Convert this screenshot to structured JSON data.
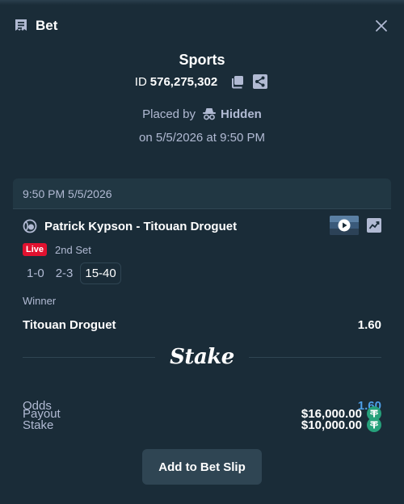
{
  "header": {
    "title": "Bet"
  },
  "bet": {
    "category": "Sports",
    "id_prefix": "ID",
    "id": "576,275,302",
    "placed_by_label": "Placed by",
    "placed_by_user": "Hidden",
    "placed_on": "on 5/5/2026 at 9:50 PM"
  },
  "card": {
    "time": "9:50 PM 5/5/2026",
    "event": "Patrick Kypson - Titouan Droguet",
    "live_badge": "Live",
    "period": "2nd Set",
    "scores": [
      "1-0",
      "2-3",
      "15-40"
    ],
    "market": "Winner",
    "selection": "Titouan Droguet",
    "selection_odds": "1.60",
    "brand": "Stake",
    "rows": {
      "odds_label": "Odds",
      "odds_value": "1.60",
      "stake_label": "Stake",
      "stake_value": "$10,000.00",
      "payout_label": "Payout",
      "payout_value": "$16,000.00"
    }
  },
  "actions": {
    "add_to_slip": "Add to Bet Slip"
  },
  "icons": {
    "title": "bet-slip-icon",
    "close": "close-icon",
    "copy": "copy-icon",
    "share": "share-icon",
    "hidden": "incognito-icon",
    "sport": "tennis-ball-icon",
    "stream": "play-icon",
    "stats": "stats-icon",
    "currency": "usdt-coin-icon"
  },
  "colors": {
    "background": "#1a2c38",
    "card": "#213743",
    "live": "#e1112f",
    "odds": "#4d9fe8",
    "coin": "#26a17b"
  }
}
